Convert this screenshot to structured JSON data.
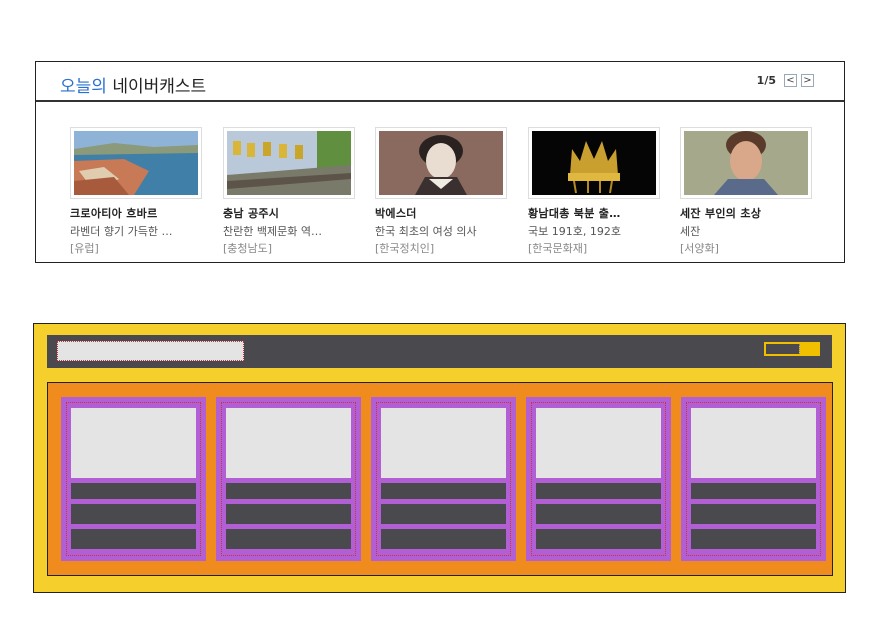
{
  "widget": {
    "title_accent": "오늘의",
    "title_rest": " 네이버캐스트",
    "pager": {
      "count": "1/5",
      "prev": "<",
      "next": ">"
    },
    "items": [
      {
        "title": "크로아티아 흐바르",
        "desc": "라벤더 향기 가득한 …",
        "category": "[유럽]",
        "thumb": "coastal-town-image"
      },
      {
        "title": "충남 공주시",
        "desc": "찬란한 백제문화 역…",
        "category": "[충청남도]",
        "thumb": "fortress-flags-image"
      },
      {
        "title": "박에스더",
        "desc": "한국 최초의 여성 의사",
        "category": "[한국정치인]",
        "thumb": "portrait-drawing-image"
      },
      {
        "title": "황남대총 북분 출…",
        "desc": "국보 191호, 192호",
        "category": "[한국문화재]",
        "thumb": "gold-crown-image"
      },
      {
        "title": "세잔 부인의 초상",
        "desc": "세잔",
        "category": "[서양화]",
        "thumb": "portrait-painting-image"
      }
    ]
  },
  "wireframe": {
    "colors": {
      "outer": "#f5d02d",
      "header": "#4a4a4e",
      "body": "#f08c1e",
      "card": "#b25fd6",
      "placeholder": "#e4e4e4"
    }
  }
}
